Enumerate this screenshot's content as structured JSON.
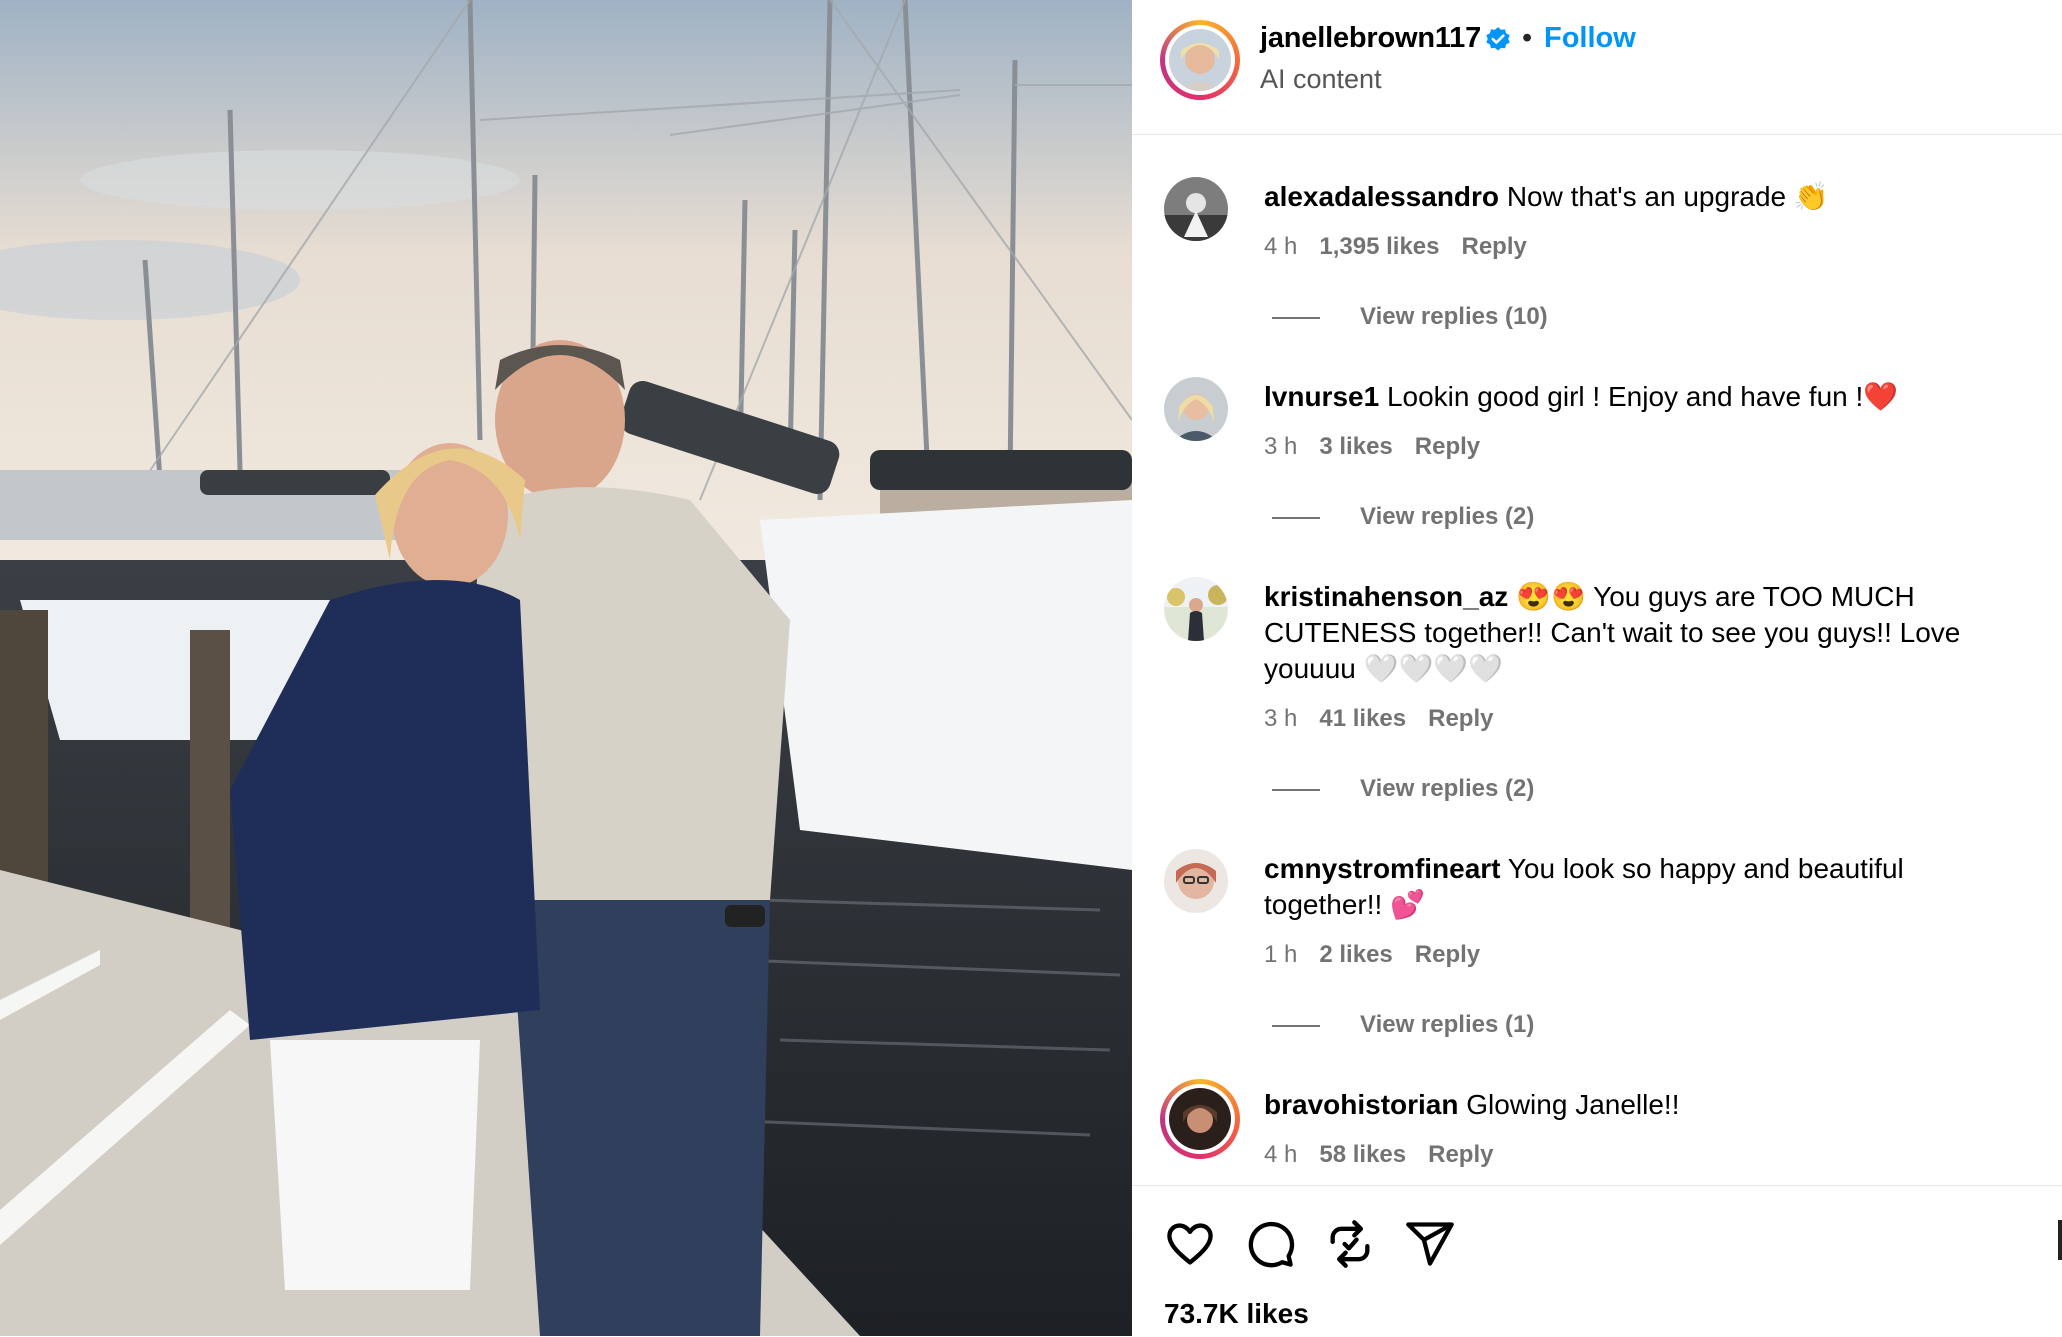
{
  "post": {
    "username": "janellebrown117",
    "separator": "•",
    "follow_label": "Follow",
    "subtitle": "AI content"
  },
  "comments": [
    {
      "username": "alexadalessandro",
      "text": "Now that's an upgrade 👏",
      "time": "4 h",
      "likes": "1,395 likes",
      "reply": "Reply",
      "view_replies": "View replies (10)"
    },
    {
      "username": "lvnurse1",
      "text": "Lookin good girl ! Enjoy and have fun !❤️",
      "time": "3 h",
      "likes": "3 likes",
      "reply": "Reply",
      "view_replies": "View replies (2)"
    },
    {
      "username": "kristinahenson_az",
      "text": "😍😍 You guys are TOO MUCH CUTENESS together!! Can't wait to see you guys!! Love youuuu 🤍🤍🤍🤍",
      "time": "3 h",
      "likes": "41 likes",
      "reply": "Reply",
      "view_replies": "View replies (2)"
    },
    {
      "username": "cmnystromfineart",
      "text": "You look so happy and beautiful together!! 💕",
      "time": "1 h",
      "likes": "2 likes",
      "reply": "Reply",
      "view_replies": "View replies (1)"
    },
    {
      "username": "bravohistorian",
      "text": "Glowing Janelle!!",
      "time": "4 h",
      "likes": "58 likes",
      "reply": "Reply"
    }
  ],
  "footer": {
    "likes_count": "73.7K likes",
    "icons": [
      "heart-icon",
      "comment-icon",
      "repost-icon",
      "share-icon"
    ]
  },
  "colors": {
    "accent": "#0095f6",
    "muted": "#737373",
    "verified": "#0095f6"
  }
}
